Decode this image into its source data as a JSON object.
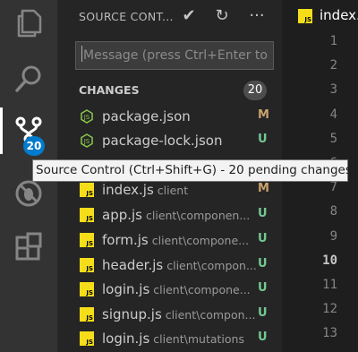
{
  "activity_bar": {
    "items": [
      {
        "name": "explorer"
      },
      {
        "name": "search"
      },
      {
        "name": "source-control",
        "badge": "20",
        "active": true
      },
      {
        "name": "debug"
      },
      {
        "name": "extensions"
      }
    ]
  },
  "sidebar": {
    "title": "SOURCE CONT...",
    "actions": {
      "commit": "✔",
      "refresh": "↻",
      "more": "···"
    },
    "message_placeholder": "Message (press Ctrl+Enter to",
    "changes": {
      "label": "CHANGES",
      "count": "20",
      "files": [
        {
          "name": "package.json",
          "dir": "",
          "status": "M",
          "icon": "node-icon"
        },
        {
          "name": "package-lock.json",
          "dir": "",
          "status": "U",
          "icon": "node-icon"
        },
        {
          "name": "",
          "dir": "",
          "status": "",
          "icon": "hidden"
        },
        {
          "name": "index.js",
          "dir": "client",
          "status": "M",
          "icon": "js-icon"
        },
        {
          "name": "app.js",
          "dir": "client\\componen...",
          "status": "U",
          "icon": "js-icon"
        },
        {
          "name": "form.js",
          "dir": "client\\compone...",
          "status": "U",
          "icon": "js-icon"
        },
        {
          "name": "header.js",
          "dir": "client\\compon...",
          "status": "U",
          "icon": "js-icon"
        },
        {
          "name": "login.js",
          "dir": "client\\compone...",
          "status": "U",
          "icon": "js-icon"
        },
        {
          "name": "signup.js",
          "dir": "client\\compon...",
          "status": "U",
          "icon": "js-icon"
        },
        {
          "name": "login.js",
          "dir": "client\\mutations",
          "status": "U",
          "icon": "js-icon"
        }
      ]
    }
  },
  "editor": {
    "tab_label": "index.",
    "tab_icon_text": "JS",
    "line_numbers": [
      "1",
      "2",
      "3",
      "4",
      "5",
      "6",
      "7",
      "8",
      "9",
      "10",
      "11",
      "12",
      "13"
    ],
    "current_line": "10"
  },
  "tooltip": {
    "text": "Source Control (Ctrl+Shift+G) - 20 pending changes"
  },
  "colors": {
    "activity_bar": "#333333",
    "sidebar": "#252526",
    "editor": "#1e1e1e",
    "badge": "#007acc",
    "modified": "#c9a26d",
    "untracked": "#73c991",
    "js_icon": "#f5de19",
    "node_icon": "#8cc84b"
  }
}
